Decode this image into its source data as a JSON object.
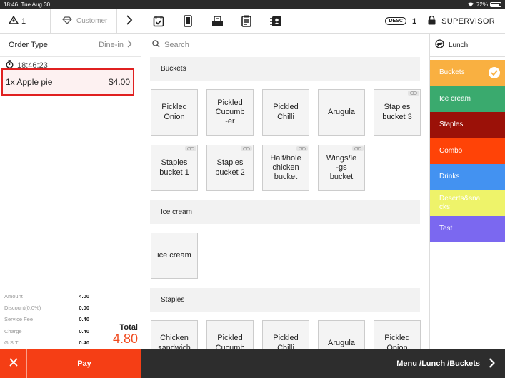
{
  "status_bar": {
    "time": "18:46",
    "date": "Tue Aug 30",
    "battery": "72%",
    "battery_level": 0.72
  },
  "toolbar": {
    "user_count": "1",
    "customer_label": "Customer",
    "desc_badge": "DESC",
    "desc_count": "1",
    "role": "SUPERVISOR",
    "icons": [
      "calendar-check-icon",
      "tablet-icon",
      "cash-drawer-icon",
      "clipboard-icon",
      "contacts-icon"
    ]
  },
  "order": {
    "type_label": "Order Type",
    "type_value": "Dine-in",
    "time": "18:46:23",
    "items": [
      {
        "name": "1x Apple pie",
        "price": "$4.00"
      }
    ]
  },
  "totals": {
    "lines": [
      {
        "label": "Amount",
        "value": "4.00"
      },
      {
        "label": "Discount(0.0%)",
        "value": "0.00"
      },
      {
        "label": "Service Fee",
        "value": "0.40"
      },
      {
        "label": "Charge",
        "value": "0.40"
      },
      {
        "label": "G.S.T.",
        "value": "0.40"
      }
    ],
    "total_label": "Total",
    "total_value": "4.80"
  },
  "bottom": {
    "pay_label": "Pay",
    "breadcrumb": "Menu /Lunch /Buckets"
  },
  "search": {
    "placeholder": "Search"
  },
  "sections": [
    {
      "title": "Buckets",
      "tiles": [
        {
          "label": "Pickled\nOnion",
          "combo": false
        },
        {
          "label": "Pickled\nCucumb\n-er",
          "combo": false
        },
        {
          "label": "Pickled\nChilli",
          "combo": false
        },
        {
          "label": "Arugula",
          "combo": false
        },
        {
          "label": "Staples\nbucket  3",
          "combo": true
        },
        {
          "label": "Staples\nbucket  1",
          "combo": true
        },
        {
          "label": "Staples\nbucket  2",
          "combo": true
        },
        {
          "label": "Half/hole\nchicken\nbucket",
          "combo": true
        },
        {
          "label": "Wings/le\n-gs\nbucket",
          "combo": true
        }
      ]
    },
    {
      "title": "Ice cream",
      "tiles": [
        {
          "label": "ice  cream",
          "combo": false
        }
      ]
    },
    {
      "title": "Staples",
      "tiles": [
        {
          "label": "Chicken\nsandwich",
          "combo": false
        },
        {
          "label": "Pickled\nCucumb",
          "combo": false
        },
        {
          "label": "Pickled\nChilli",
          "combo": false
        },
        {
          "label": "Arugula",
          "combo": false
        },
        {
          "label": "Pickled\nOnion",
          "combo": false
        }
      ]
    }
  ],
  "menu": {
    "name": "Lunch",
    "categories": [
      {
        "name": "Buckets",
        "color": "#f9b041",
        "selected": true
      },
      {
        "name": "Ice cream",
        "color": "#3aaa6e",
        "selected": false
      },
      {
        "name": "Staples",
        "color": "#9b1108",
        "selected": false
      },
      {
        "name": "Combo",
        "color": "#ff4307",
        "selected": false
      },
      {
        "name": "Drinks",
        "color": "#4392f1",
        "selected": false
      },
      {
        "name": "Deserts&snacks",
        "color": "#eef36a",
        "selected": false
      },
      {
        "name": "Test",
        "color": "#7b68f0",
        "selected": false
      }
    ]
  },
  "colors": {
    "accent": "#f53e15",
    "highlight_border": "#e02020",
    "total": "#f04a1e"
  }
}
